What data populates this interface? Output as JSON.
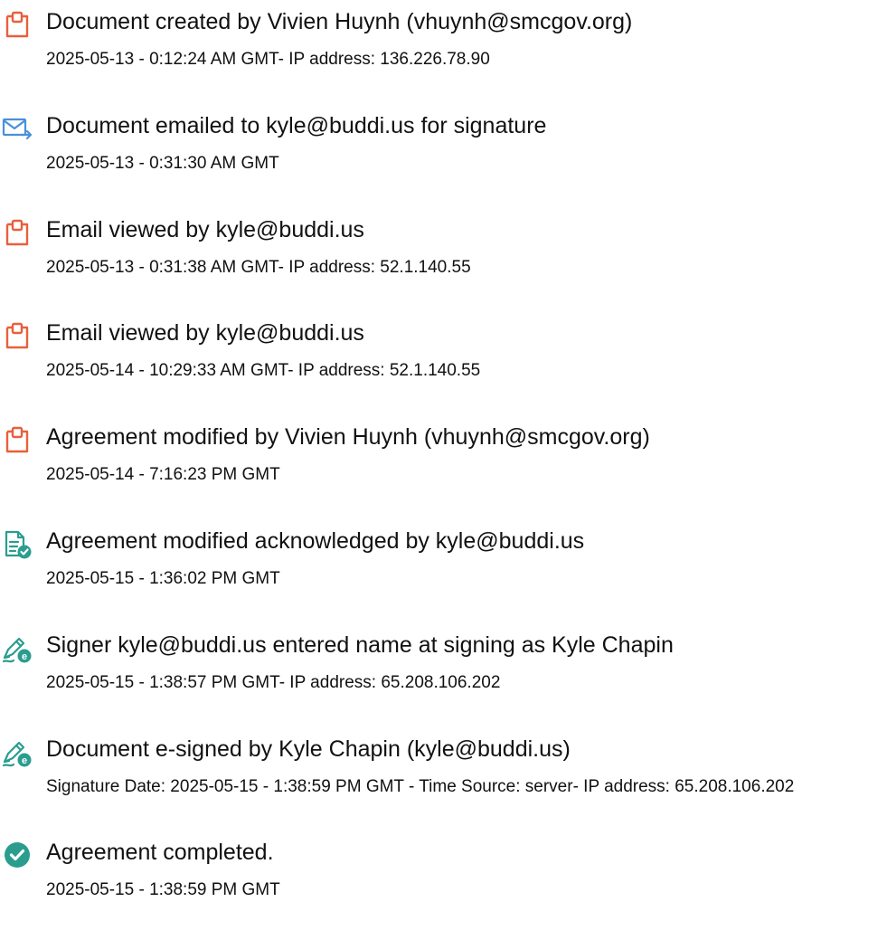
{
  "colors": {
    "orange_icon": "#e8603c",
    "blue_icon": "#4a90d9",
    "teal_icon": "#2a9d8f",
    "text": "#111111"
  },
  "events": [
    {
      "icon": "document-icon",
      "title": "Document created by Vivien Huynh (vhuynh@smcgov.org)",
      "detail": "2025-05-13 - 0:12:24 AM GMT- IP address: 136.226.78.90"
    },
    {
      "icon": "email-sent-icon",
      "title": "Document emailed to kyle@buddi.us for signature",
      "detail": "2025-05-13 - 0:31:30 AM GMT"
    },
    {
      "icon": "document-icon",
      "title": "Email viewed by kyle@buddi.us",
      "detail": "2025-05-13 - 0:31:38 AM GMT- IP address: 52.1.140.55"
    },
    {
      "icon": "document-icon",
      "title": "Email viewed by kyle@buddi.us",
      "detail": "2025-05-14 - 10:29:33 AM GMT- IP address: 52.1.140.55"
    },
    {
      "icon": "document-icon",
      "title": "Agreement modified by Vivien Huynh (vhuynh@smcgov.org)",
      "detail": "2025-05-14 - 7:16:23 PM GMT"
    },
    {
      "icon": "document-check-icon",
      "title": "Agreement modified acknowledged by kyle@buddi.us",
      "detail": "2025-05-15 - 1:36:02 PM GMT"
    },
    {
      "icon": "pen-signature-icon",
      "title": "Signer kyle@buddi.us entered name at signing as Kyle Chapin",
      "detail": "2025-05-15 - 1:38:57 PM GMT- IP address: 65.208.106.202"
    },
    {
      "icon": "pen-signature-icon",
      "title": "Document e-signed by Kyle Chapin (kyle@buddi.us)",
      "detail": "Signature Date: 2025-05-15 - 1:38:59 PM GMT - Time Source: server- IP address: 65.208.106.202"
    },
    {
      "icon": "check-circle-icon",
      "title": "Agreement completed.",
      "detail": "2025-05-15 - 1:38:59 PM GMT"
    }
  ]
}
